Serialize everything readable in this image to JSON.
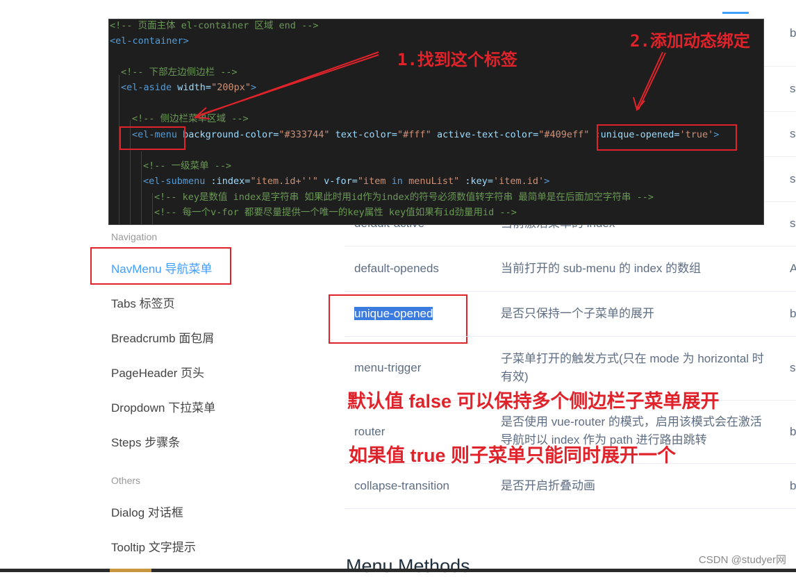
{
  "sidebar": {
    "groups": [
      {
        "label": "Navigation"
      },
      {
        "label": "Others"
      }
    ],
    "items": [
      {
        "label": "NavMenu 导航菜单"
      },
      {
        "label": "Tabs 标签页"
      },
      {
        "label": "Breadcrumb 面包屑"
      },
      {
        "label": "PageHeader 页头"
      },
      {
        "label": "Dropdown 下拉菜单"
      },
      {
        "label": "Steps 步骤条"
      },
      {
        "label": "Dialog 对话框"
      },
      {
        "label": "Tooltip 文字提示"
      }
    ]
  },
  "table": {
    "rows": [
      {
        "name": "default-active",
        "desc": "当前激活菜单的 index",
        "type": "s"
      },
      {
        "name": "default-openeds",
        "desc": "当前打开的 sub-menu 的 index 的数组",
        "type": "A"
      },
      {
        "name": "unique-opened",
        "desc": "是否只保持一个子菜单的展开",
        "type": "b"
      },
      {
        "name": "menu-trigger",
        "desc": "子菜单打开的触发方式(只在 mode 为 horizontal 时有效)",
        "type": "s"
      },
      {
        "name": "router",
        "desc": "是否使用 vue-router 的模式，启用该模式会在激活导航时以 index 作为 path 进行路由跳转",
        "type": "b"
      },
      {
        "name": "collapse-transition",
        "desc": "是否开启折叠动画",
        "type": "b"
      }
    ],
    "right_edge_types": [
      "b",
      "s",
      "s",
      "s",
      "s"
    ]
  },
  "section_title": "Menu Methods",
  "code": {
    "line1": "<!-- 页面主体 el-container 区域 end -->",
    "line2_tag": "<el-container>",
    "line3": "<!-- 下部左边侧边栏 -->",
    "line4_tag": "<el-aside",
    "line4_attr": " width=",
    "line4_val": "\"200px\"",
    "line4_end": ">",
    "line5": "<!-- 侧边栏菜单区域 -->",
    "line6_tag": "<el-menu",
    "line6_attr1": " background-color=",
    "line6_val1": "\"#333744\"",
    "line6_attr2": " text-color=",
    "line6_val2": "\"#fff\"",
    "line6_attr3": " active-text-color=",
    "line6_val3": "\"#409eff\"",
    "line6_attr4": " :unique-opened=",
    "line6_val4": "'true'",
    "line6_end": ">",
    "line7": "<!-- 一级菜单 -->",
    "line8_tag": "<el-submenu",
    "line8_attr1": " :index=",
    "line8_val1": "\"item.id+''\"",
    "line8_attr2": " v-for=",
    "line8_val2a": "\"item ",
    "line8_kw": "in",
    "line8_val2b": " menuList\"",
    "line8_attr3": " :key=",
    "line8_val3": "'item.id'",
    "line8_end": ">",
    "line9": "<!-- key是数值 index是字符串 如果此时用id作为index的符号必须数值转字符串 最简单是在后面加空字符串 -->",
    "line10": "<!-- 每一个v-for 都要尽量提供一个唯一的key属性 key值如果有id劲量用id -->"
  },
  "annotations": {
    "step1": "1.找到这个标签",
    "step2": "2.添加动态绑定",
    "note_false": "默认值 false 可以保持多个侧边栏子菜单展开",
    "note_true": "如果值 true 则子菜单只能同时展开一个"
  },
  "watermark": "CSDN @studyer网",
  "colors": {
    "accent": "#409eff",
    "annotation_red": "#e0232b",
    "code_bg": "#1e1e1e",
    "highlight": "#3b7be0"
  }
}
